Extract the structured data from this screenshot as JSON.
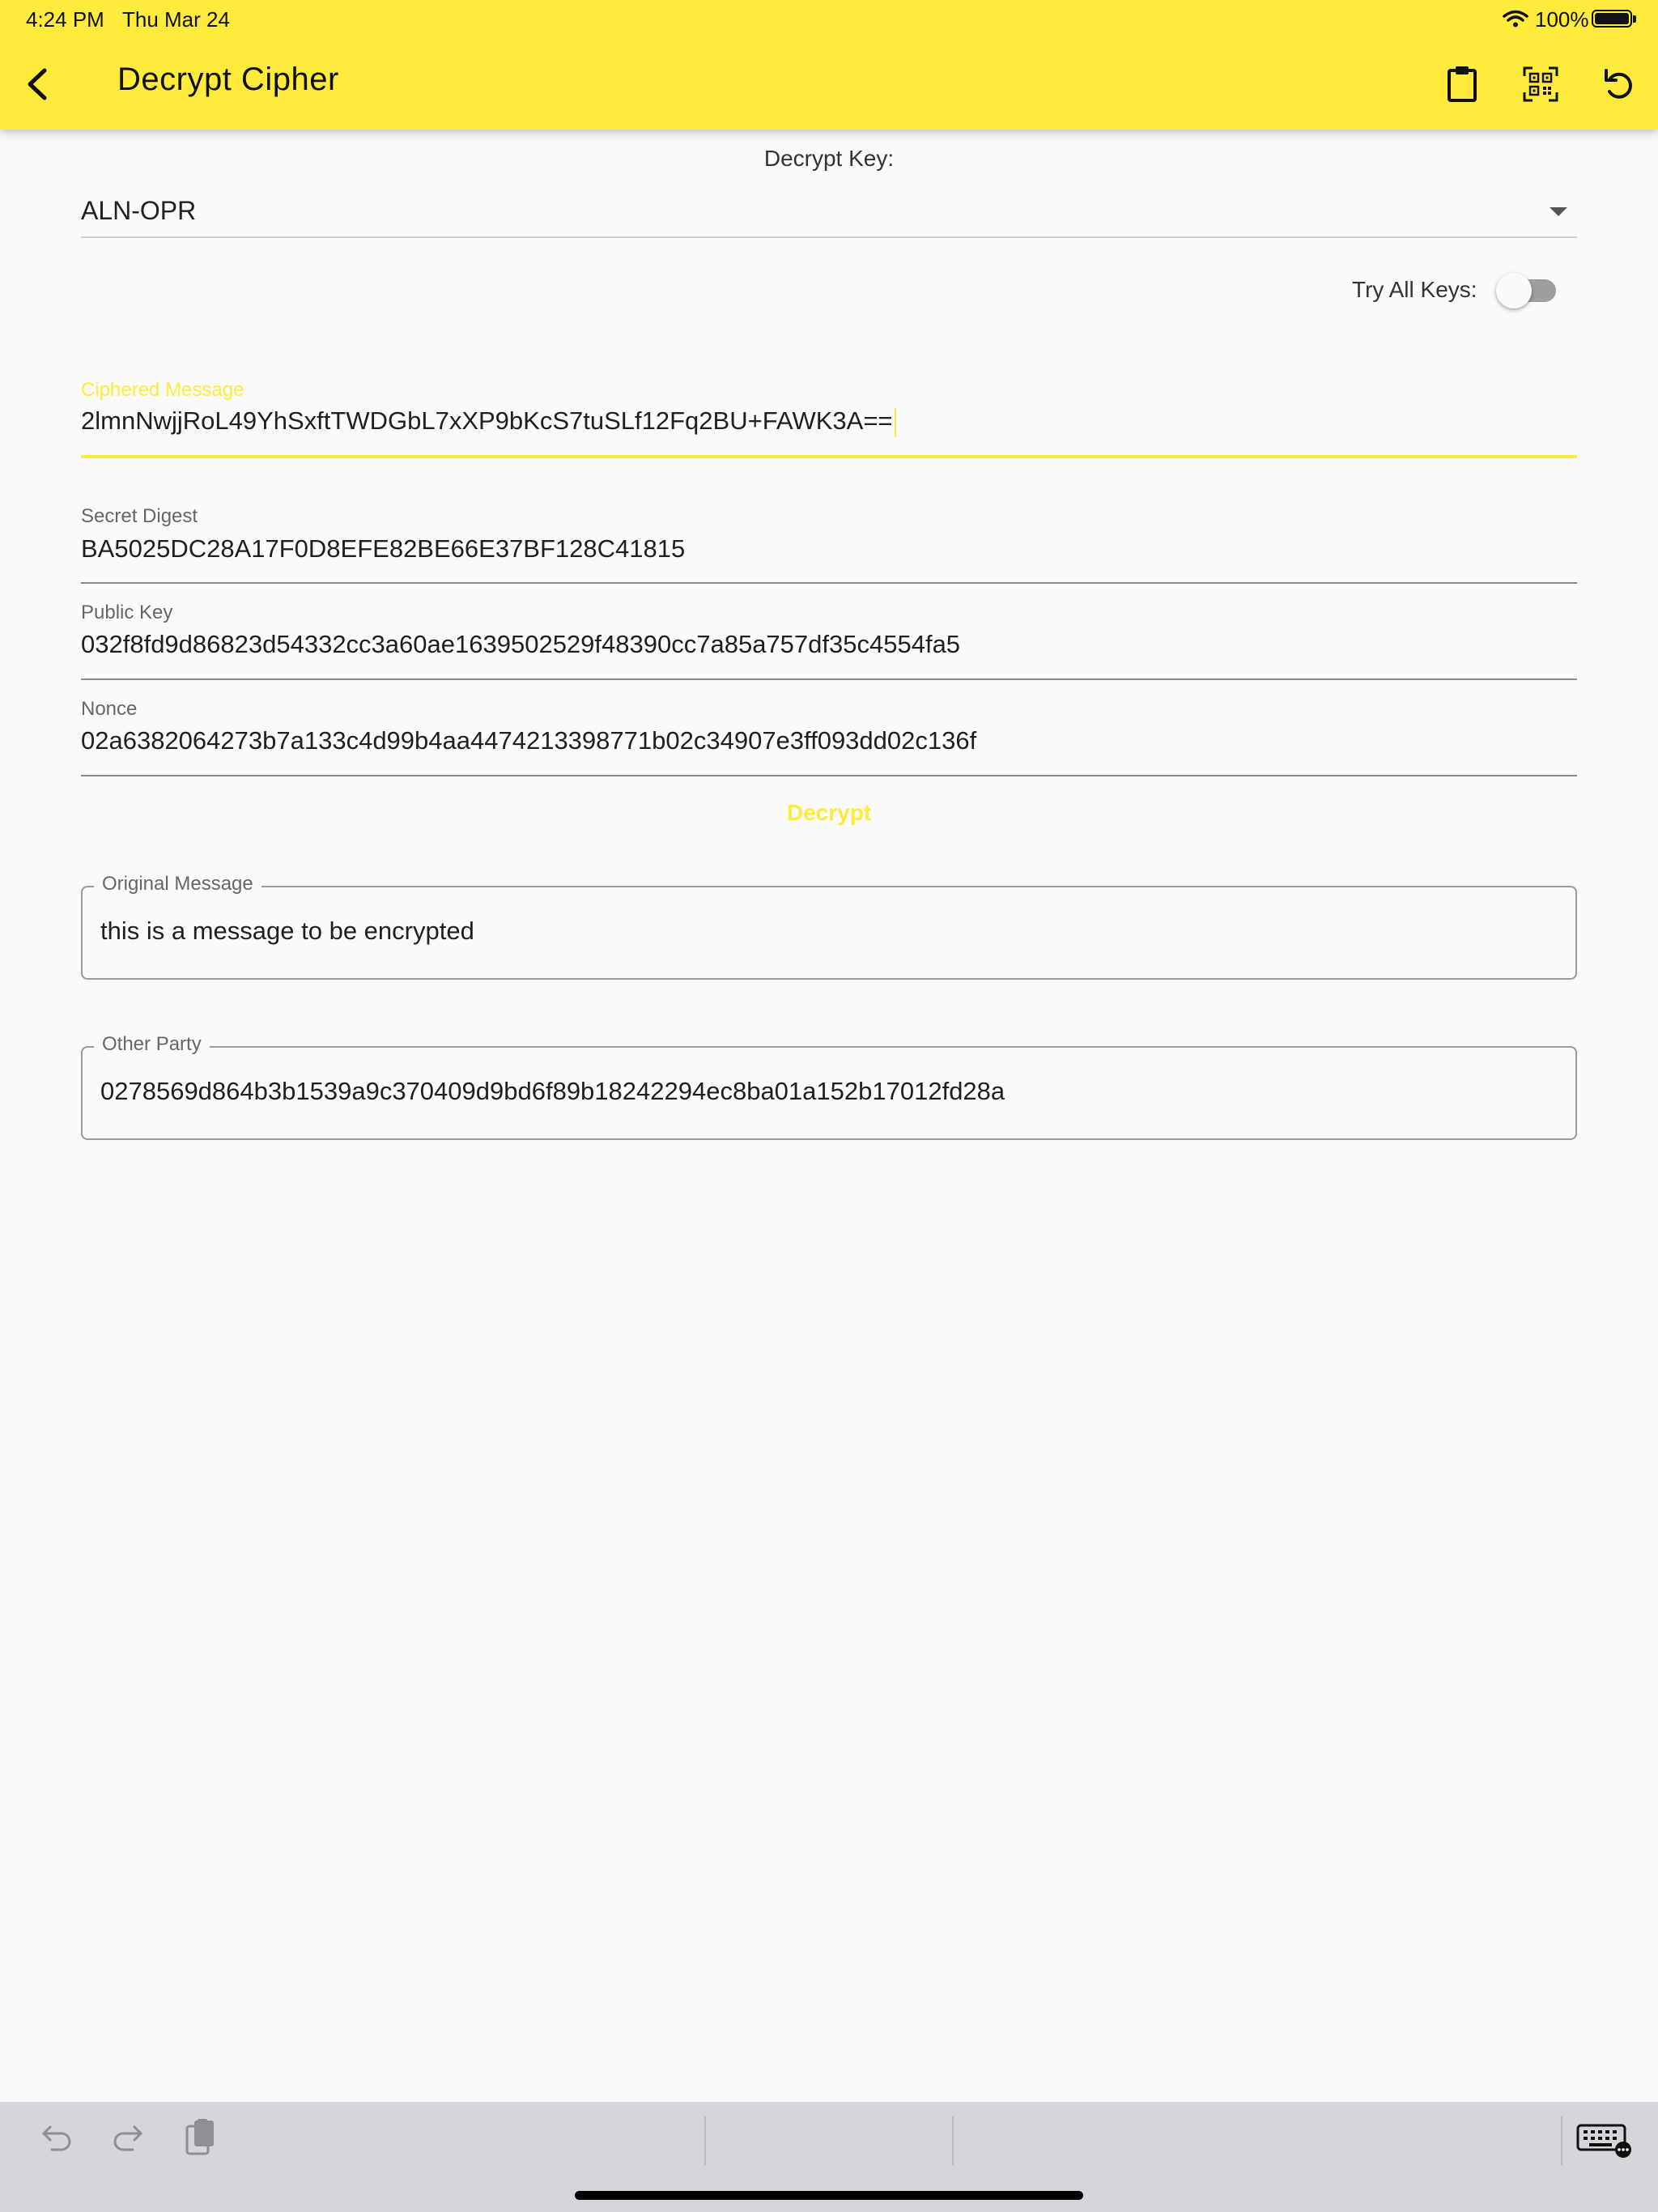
{
  "status_bar": {
    "time": "4:24 PM",
    "date": "Thu Mar 24",
    "battery": "100%",
    "icons": [
      "wifi-icon",
      "battery-icon"
    ]
  },
  "app_bar": {
    "title": "Decrypt Cipher",
    "actions": [
      "back-arrow-icon",
      "clipboard-icon",
      "qr-code-icon",
      "refresh-icon"
    ],
    "background_color": "#ffeb3b"
  },
  "decrypt_key": {
    "label": "Decrypt Key:",
    "selected": "ALN-OPR"
  },
  "try_all_keys": {
    "label": "Try All Keys:",
    "enabled": false
  },
  "ciphered_message": {
    "label": "Ciphered Message",
    "value": "2lmnNwjjRoL49YhSxftTWDGbL7xXP9bKcS7tuSLf12Fq2BU+FAWK3A=="
  },
  "secret_digest": {
    "label": "Secret Digest",
    "value": "BA5025DC28A17F0D8EFE82BE66E37BF128C41815"
  },
  "public_key": {
    "label": "Public Key",
    "value": "032f8fd9d86823d54332cc3a60ae1639502529f48390cc7a85a757df35c4554fa5"
  },
  "nonce": {
    "label": "Nonce",
    "value": "02a6382064273b7a133c4d99b4aa4474213398771b02c34907e3ff093dd02c136f"
  },
  "decrypt_button": {
    "label": "Decrypt"
  },
  "original_message": {
    "label": "Original Message",
    "value": "this is a message to be encrypted"
  },
  "other_party": {
    "label": "Other Party",
    "value": "0278569d864b3b1539a9c370409d9bd6f89b18242294ec8ba01a152b17012fd28a"
  },
  "keyboard_bar": {
    "icons": [
      "undo-icon",
      "redo-icon",
      "paste-icon",
      "keyboard-icon"
    ]
  },
  "colors": {
    "accent": "#ffeb3b",
    "background": "#fafafa",
    "keyboard_bar": "#d4d6dc"
  }
}
